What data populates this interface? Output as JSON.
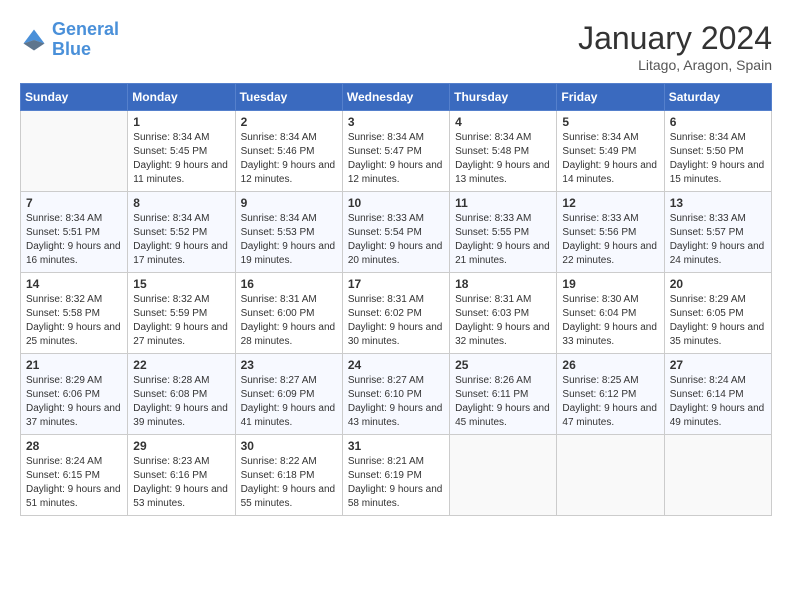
{
  "header": {
    "logo_line1": "General",
    "logo_line2": "Blue",
    "month_year": "January 2024",
    "location": "Litago, Aragon, Spain"
  },
  "weekdays": [
    "Sunday",
    "Monday",
    "Tuesday",
    "Wednesday",
    "Thursday",
    "Friday",
    "Saturday"
  ],
  "weeks": [
    [
      {
        "day": "",
        "sunrise": "",
        "sunset": "",
        "daylight": ""
      },
      {
        "day": "1",
        "sunrise": "Sunrise: 8:34 AM",
        "sunset": "Sunset: 5:45 PM",
        "daylight": "Daylight: 9 hours and 11 minutes."
      },
      {
        "day": "2",
        "sunrise": "Sunrise: 8:34 AM",
        "sunset": "Sunset: 5:46 PM",
        "daylight": "Daylight: 9 hours and 12 minutes."
      },
      {
        "day": "3",
        "sunrise": "Sunrise: 8:34 AM",
        "sunset": "Sunset: 5:47 PM",
        "daylight": "Daylight: 9 hours and 12 minutes."
      },
      {
        "day": "4",
        "sunrise": "Sunrise: 8:34 AM",
        "sunset": "Sunset: 5:48 PM",
        "daylight": "Daylight: 9 hours and 13 minutes."
      },
      {
        "day": "5",
        "sunrise": "Sunrise: 8:34 AM",
        "sunset": "Sunset: 5:49 PM",
        "daylight": "Daylight: 9 hours and 14 minutes."
      },
      {
        "day": "6",
        "sunrise": "Sunrise: 8:34 AM",
        "sunset": "Sunset: 5:50 PM",
        "daylight": "Daylight: 9 hours and 15 minutes."
      }
    ],
    [
      {
        "day": "7",
        "sunrise": "Sunrise: 8:34 AM",
        "sunset": "Sunset: 5:51 PM",
        "daylight": "Daylight: 9 hours and 16 minutes."
      },
      {
        "day": "8",
        "sunrise": "Sunrise: 8:34 AM",
        "sunset": "Sunset: 5:52 PM",
        "daylight": "Daylight: 9 hours and 17 minutes."
      },
      {
        "day": "9",
        "sunrise": "Sunrise: 8:34 AM",
        "sunset": "Sunset: 5:53 PM",
        "daylight": "Daylight: 9 hours and 19 minutes."
      },
      {
        "day": "10",
        "sunrise": "Sunrise: 8:33 AM",
        "sunset": "Sunset: 5:54 PM",
        "daylight": "Daylight: 9 hours and 20 minutes."
      },
      {
        "day": "11",
        "sunrise": "Sunrise: 8:33 AM",
        "sunset": "Sunset: 5:55 PM",
        "daylight": "Daylight: 9 hours and 21 minutes."
      },
      {
        "day": "12",
        "sunrise": "Sunrise: 8:33 AM",
        "sunset": "Sunset: 5:56 PM",
        "daylight": "Daylight: 9 hours and 22 minutes."
      },
      {
        "day": "13",
        "sunrise": "Sunrise: 8:33 AM",
        "sunset": "Sunset: 5:57 PM",
        "daylight": "Daylight: 9 hours and 24 minutes."
      }
    ],
    [
      {
        "day": "14",
        "sunrise": "Sunrise: 8:32 AM",
        "sunset": "Sunset: 5:58 PM",
        "daylight": "Daylight: 9 hours and 25 minutes."
      },
      {
        "day": "15",
        "sunrise": "Sunrise: 8:32 AM",
        "sunset": "Sunset: 5:59 PM",
        "daylight": "Daylight: 9 hours and 27 minutes."
      },
      {
        "day": "16",
        "sunrise": "Sunrise: 8:31 AM",
        "sunset": "Sunset: 6:00 PM",
        "daylight": "Daylight: 9 hours and 28 minutes."
      },
      {
        "day": "17",
        "sunrise": "Sunrise: 8:31 AM",
        "sunset": "Sunset: 6:02 PM",
        "daylight": "Daylight: 9 hours and 30 minutes."
      },
      {
        "day": "18",
        "sunrise": "Sunrise: 8:31 AM",
        "sunset": "Sunset: 6:03 PM",
        "daylight": "Daylight: 9 hours and 32 minutes."
      },
      {
        "day": "19",
        "sunrise": "Sunrise: 8:30 AM",
        "sunset": "Sunset: 6:04 PM",
        "daylight": "Daylight: 9 hours and 33 minutes."
      },
      {
        "day": "20",
        "sunrise": "Sunrise: 8:29 AM",
        "sunset": "Sunset: 6:05 PM",
        "daylight": "Daylight: 9 hours and 35 minutes."
      }
    ],
    [
      {
        "day": "21",
        "sunrise": "Sunrise: 8:29 AM",
        "sunset": "Sunset: 6:06 PM",
        "daylight": "Daylight: 9 hours and 37 minutes."
      },
      {
        "day": "22",
        "sunrise": "Sunrise: 8:28 AM",
        "sunset": "Sunset: 6:08 PM",
        "daylight": "Daylight: 9 hours and 39 minutes."
      },
      {
        "day": "23",
        "sunrise": "Sunrise: 8:27 AM",
        "sunset": "Sunset: 6:09 PM",
        "daylight": "Daylight: 9 hours and 41 minutes."
      },
      {
        "day": "24",
        "sunrise": "Sunrise: 8:27 AM",
        "sunset": "Sunset: 6:10 PM",
        "daylight": "Daylight: 9 hours and 43 minutes."
      },
      {
        "day": "25",
        "sunrise": "Sunrise: 8:26 AM",
        "sunset": "Sunset: 6:11 PM",
        "daylight": "Daylight: 9 hours and 45 minutes."
      },
      {
        "day": "26",
        "sunrise": "Sunrise: 8:25 AM",
        "sunset": "Sunset: 6:12 PM",
        "daylight": "Daylight: 9 hours and 47 minutes."
      },
      {
        "day": "27",
        "sunrise": "Sunrise: 8:24 AM",
        "sunset": "Sunset: 6:14 PM",
        "daylight": "Daylight: 9 hours and 49 minutes."
      }
    ],
    [
      {
        "day": "28",
        "sunrise": "Sunrise: 8:24 AM",
        "sunset": "Sunset: 6:15 PM",
        "daylight": "Daylight: 9 hours and 51 minutes."
      },
      {
        "day": "29",
        "sunrise": "Sunrise: 8:23 AM",
        "sunset": "Sunset: 6:16 PM",
        "daylight": "Daylight: 9 hours and 53 minutes."
      },
      {
        "day": "30",
        "sunrise": "Sunrise: 8:22 AM",
        "sunset": "Sunset: 6:18 PM",
        "daylight": "Daylight: 9 hours and 55 minutes."
      },
      {
        "day": "31",
        "sunrise": "Sunrise: 8:21 AM",
        "sunset": "Sunset: 6:19 PM",
        "daylight": "Daylight: 9 hours and 58 minutes."
      },
      {
        "day": "",
        "sunrise": "",
        "sunset": "",
        "daylight": ""
      },
      {
        "day": "",
        "sunrise": "",
        "sunset": "",
        "daylight": ""
      },
      {
        "day": "",
        "sunrise": "",
        "sunset": "",
        "daylight": ""
      }
    ]
  ]
}
